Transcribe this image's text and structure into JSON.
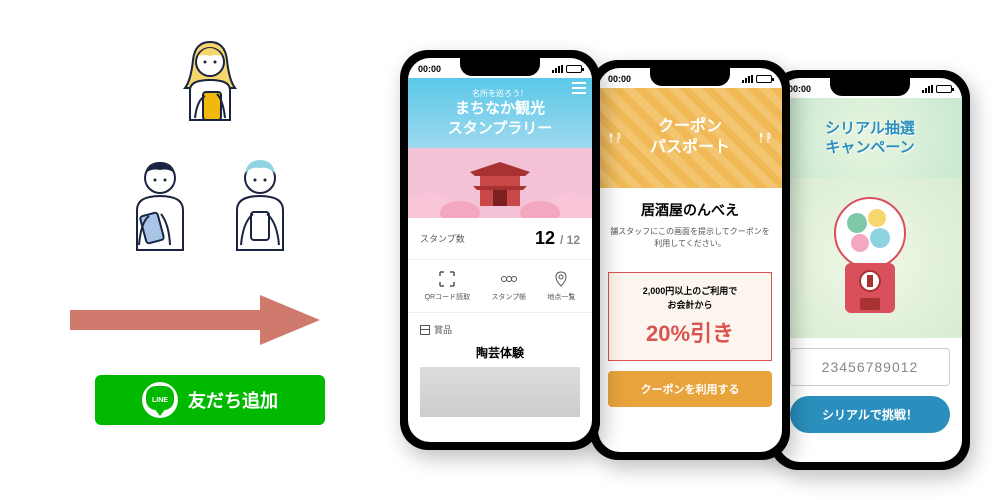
{
  "line_button": {
    "brand": "LINE",
    "label": "友だち追加"
  },
  "status_time": "00:00",
  "phone1": {
    "hero_sub": "名所を巡ろう！",
    "hero_title_l1": "まちなか観光",
    "hero_title_l2": "スタンプラリー",
    "stamp_label": "スタンプ数",
    "stamp_current": "12",
    "stamp_total": "/ 12",
    "actions": [
      {
        "label": "QRコード読取"
      },
      {
        "label": "スタンプ帳"
      },
      {
        "label": "地点一覧"
      }
    ],
    "prize_header": "賞品",
    "prize_item": "陶芸体験"
  },
  "phone2": {
    "title_l1": "クーポン",
    "title_l2": "パスポート",
    "shop_name": "居酒屋のんべえ",
    "shop_desc": "舗スタッフにこの画面を提示してクーポンを利用してください。",
    "coupon_cond_l1": "2,000円以上のご利用で",
    "coupon_cond_l2": "お会計から",
    "coupon_discount": "20%引き",
    "button": "クーポンを利用する"
  },
  "phone3": {
    "title_l1": "シリアル抽選",
    "title_l2": "キャンペーン",
    "serial_placeholder": "23456789012",
    "button": "シリアルで挑戦！"
  }
}
